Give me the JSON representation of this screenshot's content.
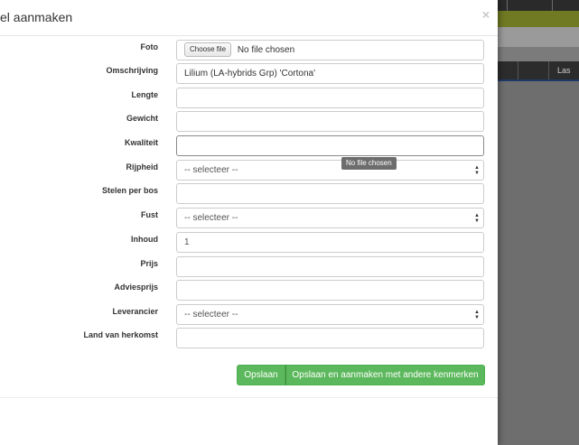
{
  "modal": {
    "title": "el aanmaken",
    "close_symbol": "×"
  },
  "form": {
    "foto": {
      "label": "Foto",
      "button": "Choose file",
      "status": "No file chosen"
    },
    "omschrijving": {
      "label": "Omschrijving",
      "value": "Lilium (LA-hybrids Grp) 'Cortona'"
    },
    "lengte": {
      "label": "Lengte",
      "value": ""
    },
    "gewicht": {
      "label": "Gewicht",
      "value": ""
    },
    "kwaliteit": {
      "label": "Kwaliteit",
      "value": ""
    },
    "rijpheid": {
      "label": "Rijpheid",
      "value": "-- selecteer --"
    },
    "stelen": {
      "label": "Stelen per bos",
      "value": ""
    },
    "fust": {
      "label": "Fust",
      "value": "-- selecteer --"
    },
    "inhoud": {
      "label": "Inhoud",
      "value": "1"
    },
    "prijs": {
      "label": "Prijs",
      "value": ""
    },
    "adviesprijs": {
      "label": "Adviesprijs",
      "value": ""
    },
    "leverancier": {
      "label": "Leverancier",
      "value": "-- selecteer --"
    },
    "land": {
      "label": "Land van herkomst",
      "value": ""
    }
  },
  "tooltip": {
    "text": "No file chosen"
  },
  "buttons": {
    "save": "Opslaan",
    "save_and_new": "Opslaan en aanmaken met andere kenmerken"
  },
  "background": {
    "table_header_last": "Las"
  },
  "colors": {
    "primary_green": "#5cb85c",
    "overlay": "#7b7b7b",
    "topbar_green": "#6f7a22"
  }
}
